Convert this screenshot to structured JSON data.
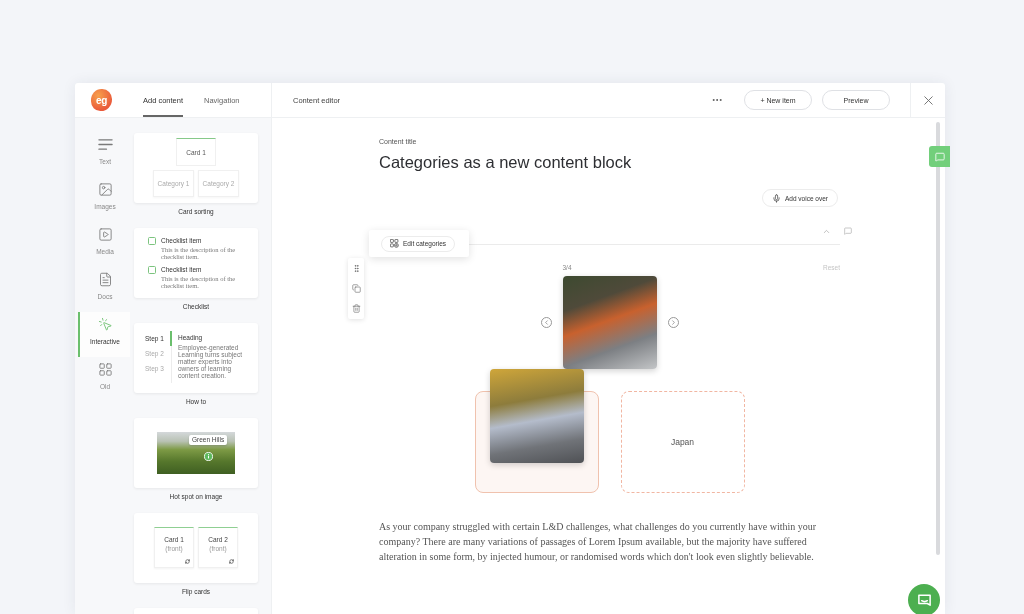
{
  "logo": {
    "text": "eg"
  },
  "tabs": [
    {
      "label": "Add content",
      "selected": true
    },
    {
      "label": "Navigation",
      "selected": false
    }
  ],
  "editor_header": {
    "title": "Content editor",
    "buttons": [
      "+ New item",
      "Preview"
    ]
  },
  "rail": [
    {
      "kind": "text",
      "label": "Text",
      "selected": false
    },
    {
      "kind": "images",
      "label": "Images",
      "selected": false
    },
    {
      "kind": "media",
      "label": "Media",
      "selected": false
    },
    {
      "kind": "docs",
      "label": "Docs",
      "selected": false
    },
    {
      "kind": "interactive",
      "label": "Interactive",
      "selected": true
    },
    {
      "kind": "old",
      "label": "Old",
      "selected": false
    }
  ],
  "blocks": [
    {
      "kind": "card_sorting",
      "label": "Card sorting",
      "preview": {
        "card": "Card 1",
        "categories": [
          "Category 1",
          "Category 2"
        ]
      }
    },
    {
      "kind": "checklist",
      "label": "Checklist",
      "preview": {
        "items": [
          {
            "title": "Checklist item",
            "description": "This is the description of the checklist item.",
            "checked": false
          },
          {
            "title": "Checklist item",
            "description": "This is the description of the checklist item.",
            "checked": false
          }
        ]
      }
    },
    {
      "kind": "how_to",
      "label": "How to",
      "preview": {
        "steps": [
          {
            "label": "Step 1",
            "selected": true
          },
          {
            "label": "Step 2",
            "selected": false
          },
          {
            "label": "Step 3",
            "selected": false
          }
        ],
        "heading": "Heading",
        "body": "Employee-generated Learning turns subject matter experts into owners of learning content creation."
      }
    },
    {
      "kind": "hotspot",
      "label": "Hot spot on image",
      "preview": {
        "tooltip": "Green Hills"
      }
    },
    {
      "kind": "flip_cards",
      "label": "Flip cards",
      "preview": {
        "cards": [
          {
            "title": "Card 1",
            "side": "(front)"
          },
          {
            "title": "Card 2",
            "side": "(front)"
          }
        ]
      }
    },
    {
      "kind": "blank"
    }
  ],
  "content": {
    "label": "Content title",
    "title": "Categories as a new content block",
    "voice_over_button": "Add voice over"
  },
  "categories_block": {
    "edit_button": "Edit categories",
    "counter": "3/4",
    "reset": {
      "label": "Reset",
      "disabled": true
    },
    "categories": [
      {
        "highlighted": true,
        "has_card": true
      },
      {
        "highlighted": false,
        "has_card": false,
        "label": "Japan"
      }
    ]
  },
  "paragraph": "As your company struggled with certain L&D challenges, what challenges do you currently have within your company? There are many variations of passages of Lorem Ipsum available, but the majority have suffered alteration in some form, by injected humour, or randomised words which don't look even slightly believable."
}
